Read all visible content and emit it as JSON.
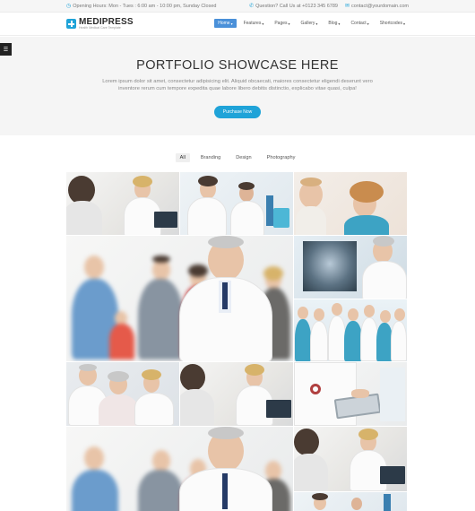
{
  "topbar": {
    "hours": "Opening Hours: Mon - Tues : 6:00 am - 10:00 pm, Sunday Closed",
    "question": "Question? Call Us at +0123 345 6789",
    "email": "contact@yourdomain.com"
  },
  "brand": {
    "name": "MEDIPRESS",
    "tagline": "Health Medical Care Template"
  },
  "nav": [
    {
      "label": "Home",
      "active": true
    },
    {
      "label": "Features",
      "active": false
    },
    {
      "label": "Pages",
      "active": false
    },
    {
      "label": "Gallery",
      "active": false
    },
    {
      "label": "Blog",
      "active": false
    },
    {
      "label": "Contact",
      "active": false
    },
    {
      "label": "Shortcodes",
      "active": false
    }
  ],
  "hero": {
    "title": "PORTFOLIO SHOWCASE HERE",
    "text": "Lorem ipsum dolor sit amet, consectetur adipisicing elit. Aliquid obcaecati, maiores consectetur eligendi deserunt vero inventore rerum cum tempore expedita quae labore libero debitis distinctio, explicabo vitae quasi, culpa!",
    "button": "Purchase Now"
  },
  "filters": [
    {
      "label": "All",
      "active": true
    },
    {
      "label": "Branding",
      "active": false
    },
    {
      "label": "Design",
      "active": false
    },
    {
      "label": "Photography",
      "active": false
    }
  ],
  "colors": {
    "accent": "#1fa3d8",
    "nav_active": "#4a90d9",
    "hero_bg": "#f5f5f5"
  }
}
